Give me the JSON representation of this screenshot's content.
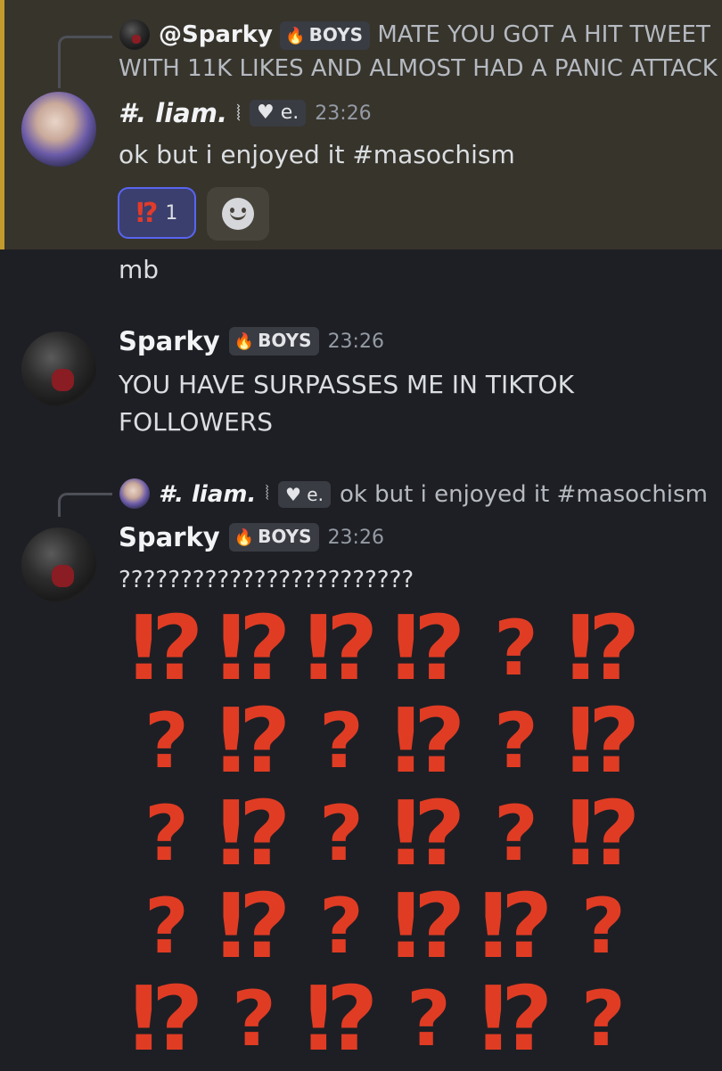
{
  "messages": {
    "m1": {
      "reply": {
        "author": "@Sparky",
        "author_tag": "BOYS",
        "text_line1": "MATE YOU GOT A HIT TWEET",
        "text_line2": "WITH 11K LIKES AND ALMOST HAD A PANIC ATTACK"
      },
      "author": "#. liam.",
      "author_suffix": "⦚",
      "author_tag": "e.",
      "timestamp": "23:26",
      "text": "ok but i enjoyed it #masochism",
      "reaction": {
        "emoji": "⁉",
        "count": "1"
      },
      "highlight_color": "#c49a2e"
    },
    "m2": {
      "text": "mb"
    },
    "m3": {
      "author": "Sparky",
      "author_tag": "BOYS",
      "timestamp": "23:26",
      "text_line1": "YOU HAVE SURPASSES ME IN TIKTOK",
      "text_line2": "FOLLOWERS"
    },
    "m4": {
      "reply": {
        "author": "#. liam.",
        "author_suffix": "⦚",
        "author_tag": "e.",
        "text": "ok but i enjoyed it #masochism"
      },
      "author": "Sparky",
      "author_tag": "BOYS",
      "timestamp": "23:26",
      "text": "????????????????????????",
      "emoji_rows": [
        [
          "⁉",
          "⁉",
          "⁉",
          "⁉",
          "?",
          "⁉"
        ],
        [
          "?",
          "⁉",
          "?",
          "⁉",
          "?",
          "⁉"
        ],
        [
          "?",
          "⁉",
          "?",
          "⁉",
          "?",
          "⁉"
        ],
        [
          "?",
          "⁉",
          "?",
          "⁉",
          "⁉",
          "?"
        ],
        [
          "⁉",
          "?",
          "⁉",
          "?",
          "⁉",
          "?"
        ]
      ]
    }
  }
}
